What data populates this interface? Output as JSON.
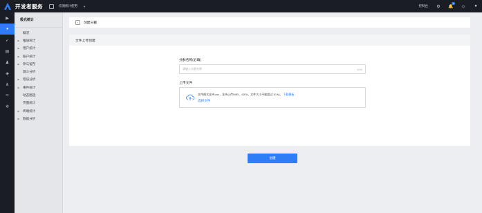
{
  "topbar": {
    "brand": "开发者服务",
    "app_name": "仅测统计使用",
    "console": "控制台",
    "notify_count": "1"
  },
  "sidebar": {
    "title": "极光统计",
    "items": [
      {
        "label": "概况",
        "arrow": false
      },
      {
        "label": "推送统计",
        "arrow": true
      },
      {
        "label": "用户统计",
        "arrow": true
      },
      {
        "label": "账户统计",
        "arrow": true
      },
      {
        "label": "参与留存",
        "arrow": true
      },
      {
        "label": "漏斗分析",
        "arrow": false
      },
      {
        "label": "错误分析",
        "arrow": true
      },
      {
        "label": "事件统计",
        "arrow": true
      },
      {
        "label": "动态圈选",
        "arrow": false
      },
      {
        "label": "页面统计",
        "arrow": false
      },
      {
        "label": "终端统计",
        "arrow": true
      },
      {
        "label": "数据分析",
        "arrow": true
      }
    ]
  },
  "breadcrumb": {
    "title": "创建分群"
  },
  "card": {
    "title": "文件上传创建",
    "name_label": "分群名称(必填)",
    "name_placeholder": "请输入分群名称",
    "name_counter": "0/40",
    "upload_label": "上传文件",
    "upload_desc": "文件格式支持.csv，支持上传IMEI、IDFA，文件大小不能超过 10 M。",
    "download_template": "下载模板",
    "choose_file": "选择文件"
  },
  "create_button": "创建",
  "colors": {
    "accent": "#2f7df6",
    "dark": "#1a1d23"
  }
}
